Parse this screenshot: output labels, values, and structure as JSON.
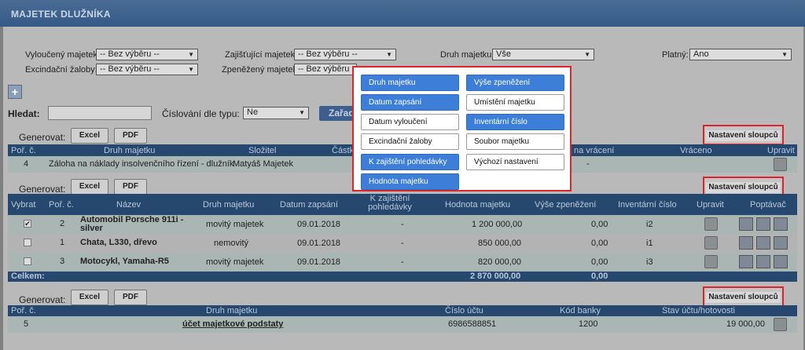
{
  "header": {
    "title": "MAJETEK DLUŽNÍKA"
  },
  "filters": {
    "vylouceny_label": "Vyloučený majetek:",
    "vylouceny_value": "-- Bez výběru --",
    "zajistujici_label": "Zajišťující majetek:",
    "zajistujici_value": "-- Bez výběru --",
    "druh_label": "Druh majetku:",
    "druh_value": "Vše",
    "platny_label": "Platný:",
    "platny_value": "Ano",
    "excindacni_label": "Excindační žaloby:",
    "excindacni_value": "-- Bez výběru --",
    "zpenezeny_label": "Zpeněžený majetek:",
    "zpenezeny_value": "-- Bez výběru --"
  },
  "search": {
    "label": "Hledat:",
    "value": "",
    "cislovani_label": "Číslování dle typu:",
    "cislovani_value": "Ne",
    "zaradit_label": "Zařad"
  },
  "generovat": {
    "label": "Generovat:",
    "excel": "Excel",
    "pdf": "PDF",
    "nastaveni": "Nastavení sloupců"
  },
  "table1": {
    "headers": [
      "Poř. č.",
      "Druh majetku",
      "Složitel",
      "Částk",
      "na vrácení",
      "Vráceno",
      "Upravit"
    ],
    "rows": [
      {
        "num": "4",
        "druh": "Záloha na náklady insolvenčního řízení - dlužník",
        "slozitel": "Matyáš Majetek",
        "navraceni": "-"
      }
    ]
  },
  "table2": {
    "headers": [
      "Vybrat",
      "Poř. č.",
      "Název",
      "Druh majetku",
      "Datum zapsání",
      "K zajištění pohledávky",
      "Hodnota majetku",
      "Výše zpeněžení",
      "Inventární číslo",
      "Upravit",
      "Poptávač"
    ],
    "rows": [
      {
        "checked": "✔",
        "num": "2",
        "nazev1": "Automobil Porsche 911i -",
        "nazev2": "silver",
        "druh": "movitý majetek",
        "datum": "09.01.2018",
        "zaj": "-",
        "hodnota": "1 200 000,00",
        "vyse": "0,00",
        "inv": "i2"
      },
      {
        "checked": "",
        "num": "1",
        "nazev1": "Chata, L330, dřevo",
        "nazev2": "",
        "druh": "nemovitý",
        "datum": "09.01.2018",
        "zaj": "-",
        "hodnota": "850 000,00",
        "vyse": "0,00",
        "inv": "i1"
      },
      {
        "checked": "",
        "num": "3",
        "nazev1": "Motocykl, Yamaha-R5",
        "nazev2": "",
        "druh": "movitý majetek",
        "datum": "09.01.2018",
        "zaj": "-",
        "hodnota": "820 000,00",
        "vyse": "0,00",
        "inv": "i3"
      }
    ],
    "total_label": "Celkem:",
    "total_hodnota": "2 870 000,00",
    "total_vyse": "0,00"
  },
  "table3": {
    "headers": [
      "Poř. č.",
      "Druh majetku",
      "Číslo účtu",
      "Kód banky",
      "Stav účtu/hotovosti"
    ],
    "rows": [
      {
        "num": "5",
        "druh": "účet majetkové podstaty",
        "ucet": "6986588851",
        "kod": "1200",
        "stav": "19 000,00"
      }
    ]
  },
  "popup": {
    "left": [
      "Druh majetku",
      "Datum zapsání",
      "Datum vyloučení",
      "Excindační žaloby",
      "K zajištění pohledávky",
      "Hodnota majetku"
    ],
    "right": [
      "Výše zpeněžení",
      "Umístění majetku",
      "Inventární číslo",
      "Soubor majetku",
      "Výchozí nastavení"
    ]
  },
  "colors": {
    "active": "#3d7fd8",
    "highlight": "#d9262b"
  }
}
